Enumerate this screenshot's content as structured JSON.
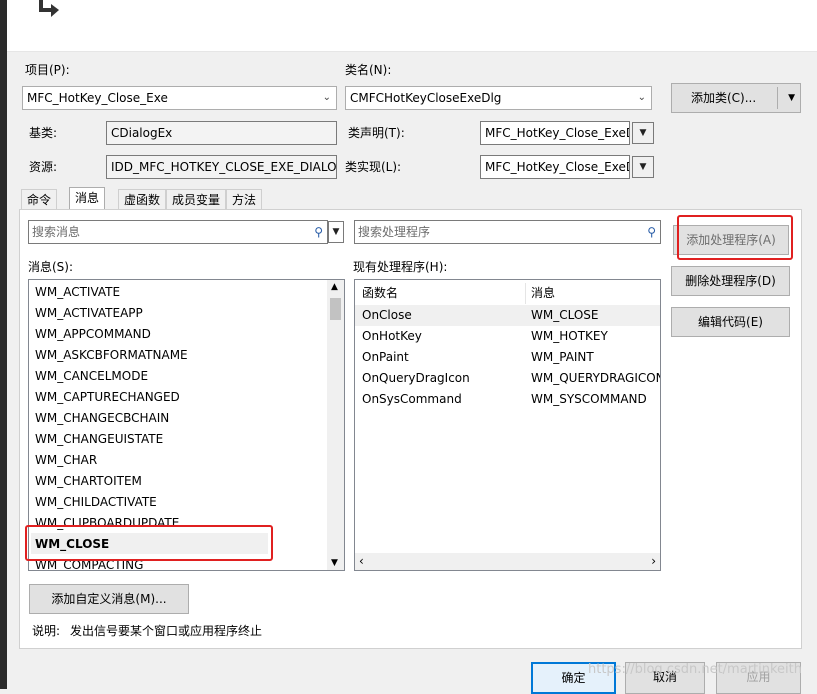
{
  "project": {
    "label": "项目(P):",
    "value": "MFC_HotKey_Close_Exe"
  },
  "classname": {
    "label": "类名(N):",
    "value": "CMFCHotKeyCloseExeDlg"
  },
  "add_class_button": "添加类(C)...",
  "base_class": {
    "label": "基类:",
    "value": "CDialogEx"
  },
  "class_decl": {
    "label": "类声明(T):",
    "value": "MFC_HotKey_Close_ExeD"
  },
  "resource": {
    "label": "资源:",
    "value": "IDD_MFC_HOTKEY_CLOSE_EXE_DIALOG"
  },
  "class_impl": {
    "label": "类实现(L):",
    "value": "MFC_HotKey_Close_ExeD"
  },
  "tabs": [
    "命令",
    "消息",
    "虚函数",
    "成员变量",
    "方法"
  ],
  "search_messages_placeholder": "搜索消息",
  "search_handlers_placeholder": "搜索处理程序",
  "messages_label": "消息(S):",
  "existing_handlers_label": "现有处理程序(H):",
  "messages": [
    "WM_ACTIVATE",
    "WM_ACTIVATEAPP",
    "WM_APPCOMMAND",
    "WM_ASKCBFORMATNAME",
    "WM_CANCELMODE",
    "WM_CAPTURECHANGED",
    "WM_CHANGECBCHAIN",
    "WM_CHANGEUISTATE",
    "WM_CHAR",
    "WM_CHARTOITEM",
    "WM_CHILDACTIVATE",
    "WM_CLIPBOARDUPDATE",
    "WM_CLOSE",
    "WM_COMPACTING"
  ],
  "selected_message_index": 12,
  "handlers_columns": [
    "函数名",
    "消息"
  ],
  "handlers": [
    {
      "func": "OnClose",
      "msg": "WM_CLOSE"
    },
    {
      "func": "OnHotKey",
      "msg": "WM_HOTKEY"
    },
    {
      "func": "OnPaint",
      "msg": "WM_PAINT"
    },
    {
      "func": "OnQueryDragIcon",
      "msg": "WM_QUERYDRAGICON"
    },
    {
      "func": "OnSysCommand",
      "msg": "WM_SYSCOMMAND"
    }
  ],
  "buttons": {
    "add_handler": "添加处理程序(A)",
    "delete_handler": "删除处理程序(D)",
    "edit_code": "编辑代码(E)",
    "add_custom_message": "添加自定义消息(M)...",
    "ok": "确定",
    "cancel": "取消",
    "apply": "应用"
  },
  "description": {
    "label": "说明:",
    "text": "发出信号要某个窗口或应用程序终止"
  },
  "watermark": "https://blog.csdn.net/martinkeith"
}
